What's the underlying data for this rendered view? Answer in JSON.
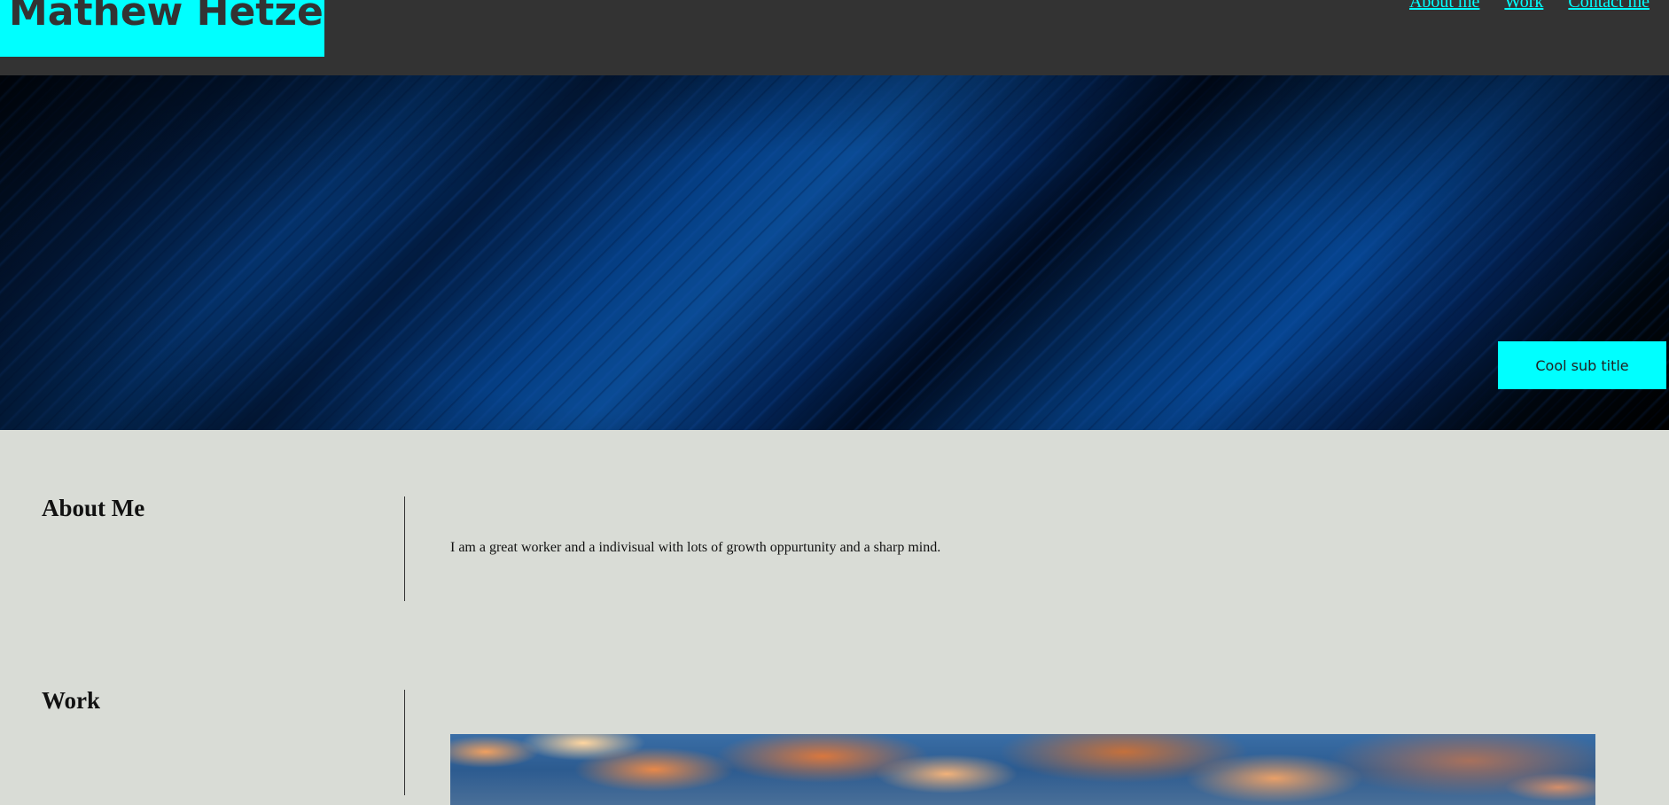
{
  "header": {
    "site_title": "Mathew Hetzel",
    "nav": [
      {
        "label": "About me"
      },
      {
        "label": "Work"
      },
      {
        "label": "Contact me"
      }
    ]
  },
  "hero": {
    "subtitle": "Cool sub title"
  },
  "about": {
    "heading": "About Me",
    "text": "I am a great worker and a indivisual with lots of growth oppurtunity and a sharp mind."
  },
  "work": {
    "heading": "Work"
  },
  "colors": {
    "accent": "#00ffff",
    "header_bg": "#333333",
    "page_bg": "#d9dcd6"
  }
}
